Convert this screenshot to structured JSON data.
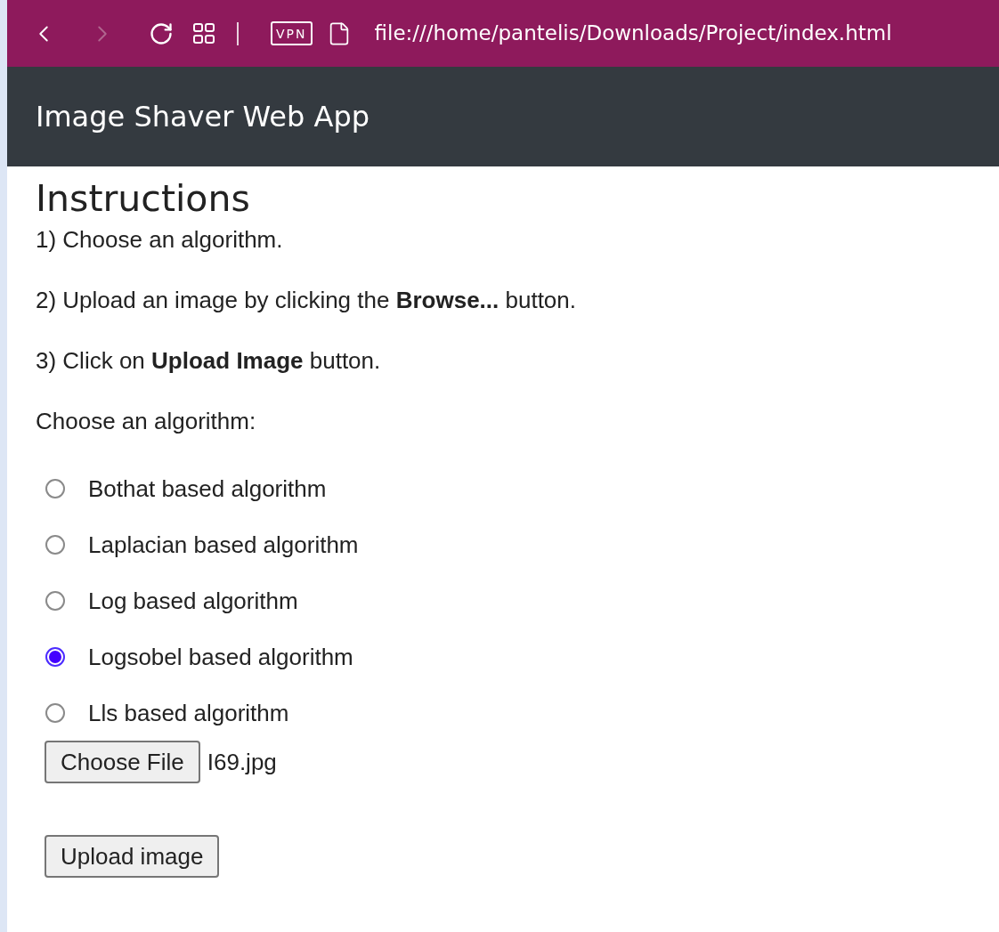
{
  "browser": {
    "forward_disabled": true,
    "vpn_label": "VPN",
    "address": "file:///home/pantelis/Downloads/Project/index.html"
  },
  "navbar": {
    "brand": "Image Shaver Web App"
  },
  "heading": "Instructions",
  "steps": [
    "1) Choose an algorithm.",
    "2) Upload an image by clicking the **Browse...** button.",
    "3) Click on **Upload Image** button."
  ],
  "prompt": "Choose an algorithm:",
  "algorithms": [
    {
      "label": "Bothat based algorithm",
      "selected": false
    },
    {
      "label": "Laplacian based algorithm",
      "selected": false
    },
    {
      "label": "Log based algorithm",
      "selected": false
    },
    {
      "label": "Logsobel based algorithm",
      "selected": true
    },
    {
      "label": "Lls based algorithm",
      "selected": false
    }
  ],
  "file_input": {
    "button": "Choose File",
    "file_name": "I69.jpg"
  },
  "upload_button": "Upload image"
}
